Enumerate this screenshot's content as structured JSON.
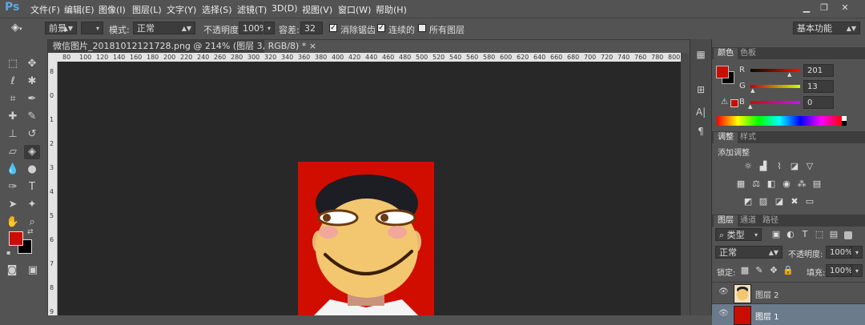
{
  "app": {
    "logo": "Ps"
  },
  "menu": [
    "文件(F)",
    "编辑(E)",
    "图像(I)",
    "图层(L)",
    "文字(Y)",
    "选择(S)",
    "滤镜(T)",
    "3D(D)",
    "视图(V)",
    "窗口(W)",
    "帮助(H)"
  ],
  "window_controls": {
    "minimize": "▁",
    "restore": "❐",
    "close": "✕"
  },
  "options": {
    "fill_source": "前景",
    "mode_label": "模式:",
    "mode_value": "正常",
    "opacity_label": "不透明度:",
    "opacity_value": "100%",
    "tolerance_label": "容差:",
    "tolerance_value": "32",
    "antialias_label": "消除锯齿",
    "contiguous_label": "连续的",
    "all_layers_label": "所有图层",
    "workspace": "基本功能"
  },
  "document": {
    "tab_title": "微信图片_20181012121728.png @ 214% (图层 3, RGB/8) * ",
    "tab_close": "×",
    "ruler_top": [
      "80",
      "100",
      "120",
      "140",
      "160",
      "180",
      "200",
      "220",
      "240",
      "260",
      "280",
      "300",
      "320",
      "340",
      "360",
      "380",
      "400",
      "420",
      "440",
      "460",
      "480",
      "500",
      "520",
      "540",
      "560",
      "580",
      "600",
      "620",
      "640",
      "660",
      "680",
      "700",
      "720",
      "740",
      "760",
      "780",
      "800"
    ],
    "ruler_left": [
      "8",
      "0",
      "1",
      "2",
      "3",
      "4",
      "5",
      "6",
      "7",
      "8",
      "9"
    ]
  },
  "color_panel": {
    "tabs": [
      "颜色",
      "色板"
    ],
    "foreground": "#c90d00",
    "channels": [
      {
        "label": "R",
        "value": "201",
        "fraction": 0.79
      },
      {
        "label": "G",
        "value": "13",
        "fraction": 0.05
      },
      {
        "label": "B",
        "value": "0",
        "fraction": 0.0
      }
    ]
  },
  "adjust_panel": {
    "tabs": [
      "调整",
      "样式"
    ],
    "title": "添加调整"
  },
  "layers_panel": {
    "tabs": [
      "图层",
      "通道",
      "路径"
    ],
    "filter_kind": "类型",
    "blend_mode": "正常",
    "opacity_label": "不透明度:",
    "opacity_value": "100%",
    "lock_label": "锁定:",
    "fill_label": "填充:",
    "fill_value": "100%",
    "layers": [
      {
        "name": "图层 2"
      },
      {
        "name": "图层 1"
      }
    ]
  }
}
